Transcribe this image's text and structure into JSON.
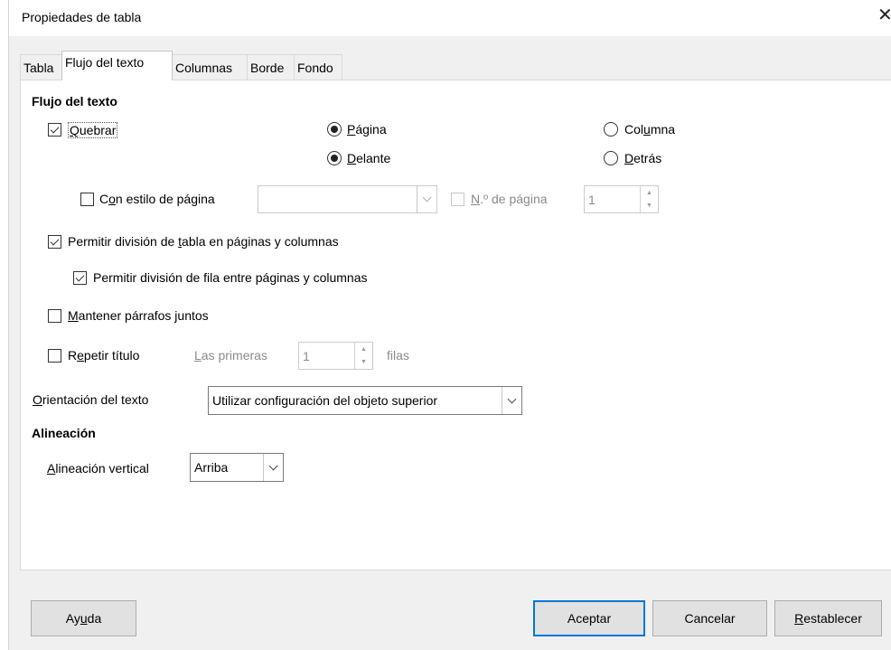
{
  "window": {
    "title": "Propiedades de tabla",
    "close_glyph": "✕"
  },
  "tabs": [
    {
      "label": "Tabla"
    },
    {
      "label": "Flujo del texto"
    },
    {
      "label": "Columnas"
    },
    {
      "label": "Borde"
    },
    {
      "label": "Fondo"
    }
  ],
  "active_tab": "Flujo del texto",
  "flow": {
    "section": "Flujo del texto",
    "break_pre": "",
    "break_u": "Q",
    "break_post": "uebrar",
    "break_checked": true,
    "page_pre": "",
    "page_u": "P",
    "page_post": "ágina",
    "page_selected": true,
    "column_pre": "Col",
    "column_u": "u",
    "column_post": "mna",
    "column_selected": false,
    "before_pre": "",
    "before_u": "D",
    "before_post": "elante",
    "before_selected": true,
    "after_pre": "",
    "after_u": "D",
    "after_post": "etrás",
    "after_selected": false,
    "page_style_pre": "C",
    "page_style_u": "o",
    "page_style_post": "n estilo de página",
    "page_style_checked": false,
    "page_style_value": "",
    "page_num_pre": "",
    "page_num_u": "N",
    "page_num_post": ".º de página",
    "page_num_checked": false,
    "page_num_value": "1",
    "allow_split_pre": "Permitir división de ",
    "allow_split_u": "t",
    "allow_split_post": "abla en páginas y columnas",
    "allow_split_checked": true,
    "allow_row_pre": "Permitir división de fila entre pá",
    "allow_row_u": "g",
    "allow_row_post": "inas y columnas",
    "allow_row_checked": true,
    "keep_pre": "",
    "keep_u": "M",
    "keep_post": "antener párrafos juntos",
    "keep_checked": false,
    "repeat_pre": "R",
    "repeat_u": "e",
    "repeat_post": "petir título",
    "repeat_checked": false,
    "first_pre": "",
    "first_u": "L",
    "first_post": "as primeras",
    "first_value": "1",
    "rows_label": "filas",
    "orient_pre": "",
    "orient_u": "O",
    "orient_post": "rientación del texto",
    "orient_value": "Utilizar configuración del objeto superior"
  },
  "alignment": {
    "section": "Alineación",
    "vertical_pre": "",
    "vertical_u": "A",
    "vertical_post": "lineación vertical",
    "vertical_value": "Arriba"
  },
  "buttons": {
    "help_pre": "Ay",
    "help_u": "u",
    "help_post": "da",
    "ok": "Aceptar",
    "cancel": "Cancelar",
    "reset_pre": "",
    "reset_u": "R",
    "reset_post": "establecer"
  },
  "colors": {
    "accent": "#0078d7",
    "button": "#e1e1e1",
    "dialog": "#f0f0f0",
    "panel": "#ffffff"
  }
}
